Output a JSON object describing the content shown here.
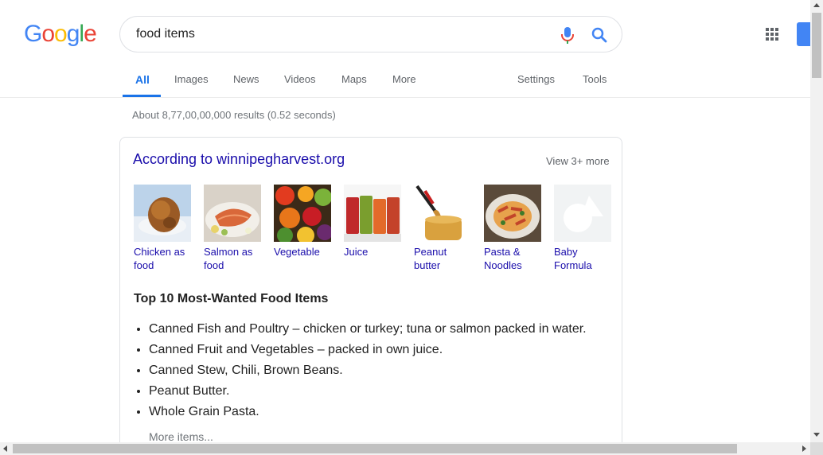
{
  "header": {
    "logo_letters": [
      "G",
      "o",
      "o",
      "g",
      "l",
      "e"
    ],
    "logo_colors": [
      "#4285f4",
      "#ea4335",
      "#fbbc05",
      "#4285f4",
      "#34a853",
      "#ea4335"
    ],
    "search_value": "food items",
    "mic_icon": "microphone-icon",
    "search_icon": "magnifier-icon",
    "apps_icon": "apps-grid-icon"
  },
  "tabs": {
    "all": "All",
    "images": "Images",
    "news": "News",
    "videos": "Videos",
    "maps": "Maps",
    "more": "More",
    "settings": "Settings",
    "tools": "Tools"
  },
  "stats": "About 8,77,00,00,000 results (0.52 seconds)",
  "card": {
    "title": "According to winnipegharvest.org",
    "view_more": "View 3+ more",
    "items": [
      {
        "label": "Chicken as\nfood",
        "image": "roast-chicken"
      },
      {
        "label": "Salmon as\nfood",
        "image": "salmon-dish"
      },
      {
        "label": "Vegetable",
        "image": "vegetables"
      },
      {
        "label": "Juice",
        "image": "juice-glasses"
      },
      {
        "label": "Peanut\nbutter",
        "image": "peanut-butter-jar"
      },
      {
        "label": "Pasta &\nNoodles",
        "image": "pasta-plate"
      },
      {
        "label": "Baby\nFormula",
        "image": "placeholder-shapes"
      }
    ],
    "list_heading": "Top 10 Most-Wanted Food Items",
    "bullets": [
      "Canned Fish and Poultry – chicken or turkey; tuna or salmon packed in water.",
      "Canned Fruit and Vegetables – packed in own juice.",
      "Canned Stew, Chili, Brown Beans.",
      "Peanut Butter.",
      "Whole Grain Pasta."
    ],
    "more_items": "More items..."
  },
  "colors": {
    "link": "#1a0dab",
    "active_tab": "#1a73e8",
    "muted": "#70757a"
  }
}
